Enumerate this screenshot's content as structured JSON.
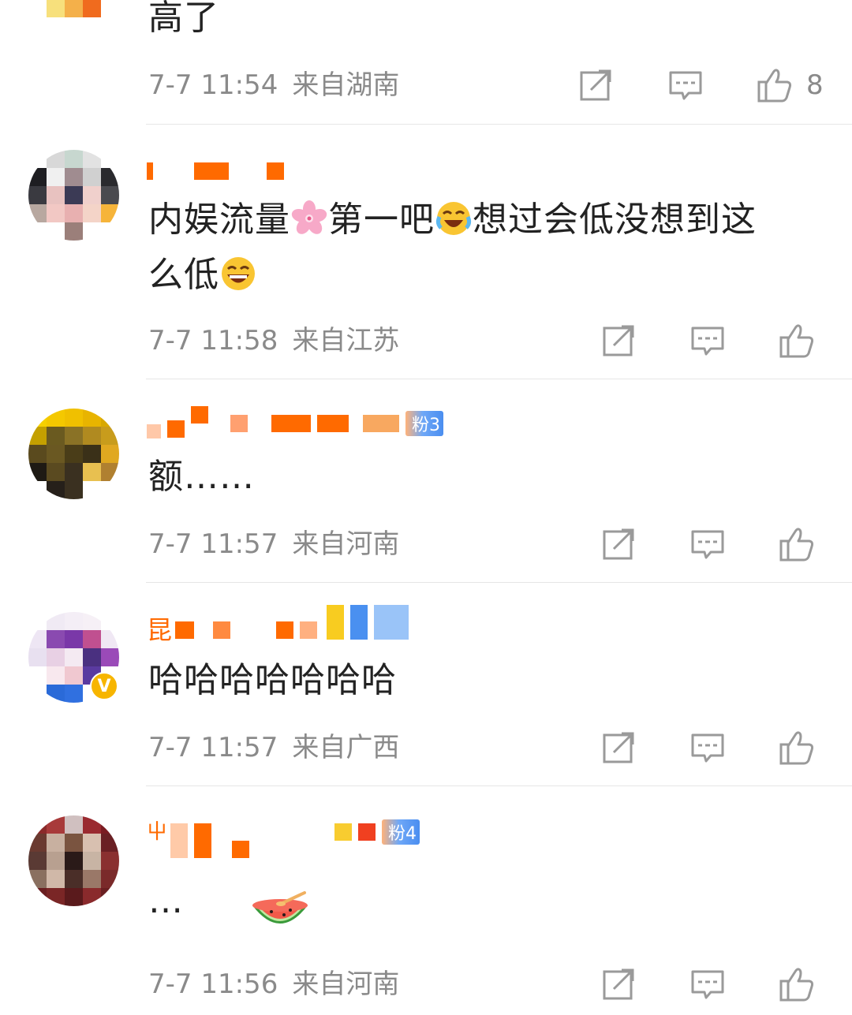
{
  "comments": [
    {
      "text": "高了",
      "time": "7-7 11:54",
      "location": "来自湖南",
      "likes": "8"
    },
    {
      "username_first": "",
      "text_before_1": "内娱流量",
      "text_between": "第一吧",
      "text_after": "想过会低没想到这",
      "text_line2": "么低",
      "time": "7-7 11:58",
      "location": "来自江苏",
      "emojis": [
        "cherry-blossom-emoji",
        "crying-laughing-emoji",
        "laughing-emoji"
      ]
    },
    {
      "fan_badge": "粉3",
      "text": "额……",
      "time": "7-7 11:57",
      "location": "来自河南"
    },
    {
      "username_first": "昆",
      "text": "哈哈哈哈哈哈哈",
      "time": "7-7 11:57",
      "location": "来自广西",
      "verified": "V"
    },
    {
      "username_first": "屮",
      "fan_badge": "粉4",
      "text": "…",
      "time": "7-7 11:56",
      "location": "来自河南",
      "sticker": "watermelon-sticker"
    }
  ],
  "icons": {
    "repost": "repost-icon",
    "comment": "comment-icon",
    "like": "thumbs-up-icon"
  },
  "colors": {
    "username": "#ff6a00",
    "meta": "#8a8a8a",
    "icon": "#9a9a9a",
    "divider": "#e6e6e6"
  }
}
